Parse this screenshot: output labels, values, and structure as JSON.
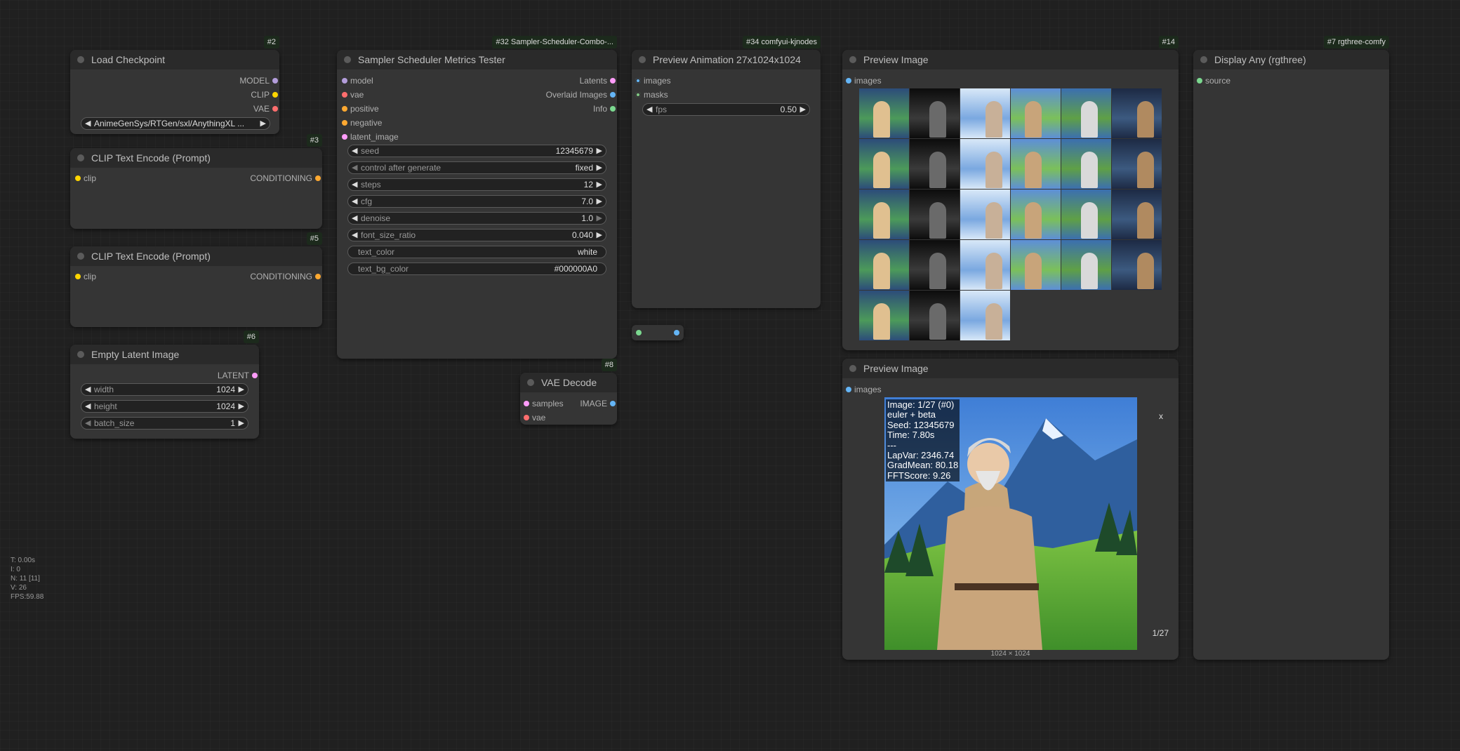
{
  "nodes": {
    "load_checkpoint": {
      "id": "#2",
      "title": "Load Checkpoint",
      "outputs": [
        "MODEL",
        "CLIP",
        "VAE"
      ],
      "ckpt_name": "AnimeGenSys/RTGen/sxl/AnythingXL ..."
    },
    "clip_text_3": {
      "id": "#3",
      "title": "CLIP Text Encode (Prompt)",
      "input": "clip",
      "output": "CONDITIONING"
    },
    "clip_text_5": {
      "id": "#5",
      "title": "CLIP Text Encode (Prompt)",
      "input": "clip",
      "output": "CONDITIONING"
    },
    "empty_latent": {
      "id": "#6",
      "title": "Empty Latent Image",
      "output": "LATENT",
      "widgets": [
        {
          "label": "width",
          "value": "1024"
        },
        {
          "label": "height",
          "value": "1024"
        },
        {
          "label": "batch_size",
          "value": "1"
        }
      ]
    },
    "sampler_tester": {
      "id": "#32 Sampler-Scheduler-Combo-...",
      "title": "Sampler Scheduler Metrics Tester",
      "inputs": [
        "model",
        "vae",
        "positive",
        "negative",
        "latent_image"
      ],
      "outputs": [
        "Latents",
        "Overlaid Images",
        "Info"
      ],
      "widgets": [
        {
          "label": "seed",
          "value": "12345679"
        },
        {
          "label": "control after generate",
          "value": "fixed"
        },
        {
          "label": "steps",
          "value": "12"
        },
        {
          "label": "cfg",
          "value": "7.0"
        },
        {
          "label": "denoise",
          "value": "1.0"
        },
        {
          "label": "font_size_ratio",
          "value": "0.040"
        },
        {
          "label": "text_color",
          "value": "white"
        },
        {
          "label": "text_bg_color",
          "value": "#000000A0"
        }
      ]
    },
    "vae_decode": {
      "id": "#8",
      "title": "VAE Decode",
      "inputs": [
        "samples",
        "vae"
      ],
      "output": "IMAGE"
    },
    "preview_animation": {
      "id": "#34 comfyui-kjnodes",
      "title": "Preview Animation 27x1024x1024",
      "inputs": [
        "images",
        "masks"
      ],
      "fps_label": "fps",
      "fps_value": "0.50"
    },
    "preview_image_14": {
      "id": "#14",
      "title": "Preview Image",
      "input": "images"
    },
    "preview_image_2": {
      "title": "Preview Image",
      "input": "images",
      "overlay_lines": [
        "Image: 1/27 (#0)",
        "euler + beta",
        "Seed: 12345679",
        "Time: 7.80s",
        "---",
        "LapVar: 2346.74",
        "GradMean: 80.18",
        "FFTScore: 9.26"
      ],
      "close_label": "x",
      "counter": "1/27",
      "dims": "1024 × 1024"
    },
    "display_any": {
      "id": "#7 rgthree-comfy",
      "title": "Display Any (rgthree)",
      "input": "source"
    }
  },
  "stats": [
    "T: 0.00s",
    "I: 0",
    "N: 11 [11]",
    "V: 26",
    "FPS:59.88"
  ],
  "colors": {
    "model": "#b39ddb",
    "clip": "#ffd500",
    "vae": "#ff6e6e",
    "conditioning": "#ffa931",
    "latent": "#ff9cf9",
    "image": "#64b5f6",
    "mask": "#81c784",
    "info": "#7bd88f"
  }
}
